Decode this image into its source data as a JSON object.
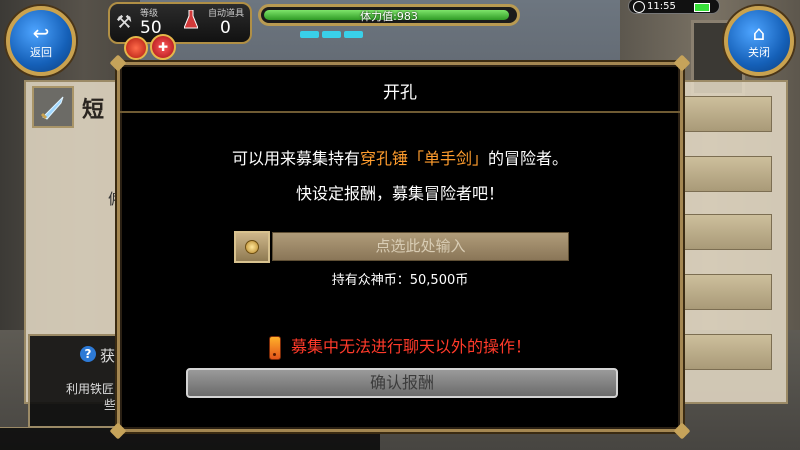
{
  "hud": {
    "back_label": "返回",
    "close_label": "关闭",
    "level_label": "等级",
    "level_value": "50",
    "auto_item_label": "自动道具",
    "auto_item_value": "0",
    "stamina_text": "体力值:983",
    "stamina_fraction": 0.98,
    "clock": "11:55"
  },
  "background": {
    "panel_title": "短",
    "left_letter": "僱",
    "help_title": "获得",
    "help_line1": "利用铁匠",
    "help_line2": "些"
  },
  "dialog": {
    "title": "开孔",
    "line1_prefix": "可以用来募集持有",
    "line1_highlight": "穿孔锤「单手剑」",
    "line1_suffix": "的冒险者。",
    "line2": "快设定报酬，募集冒险者吧！",
    "input_placeholder": "点选此处输入",
    "holding_text": "持有众神币：50,500币",
    "warning": "募集中无法进行聊天以外的操作！",
    "confirm_label": "确认报酬"
  },
  "colors": {
    "highlight": "#ff9d2e",
    "warning": "#ff3a2a",
    "stamina": "#2f9a25",
    "frame_gold": "#a48752"
  },
  "icons": [
    "back-arrow-icon",
    "home-icon",
    "wrench-icon",
    "flask-icon",
    "medal-icon",
    "gift-icon",
    "coin-icon",
    "warning-icon",
    "help-icon",
    "sword-icon",
    "clock-icon",
    "battery-icon"
  ]
}
